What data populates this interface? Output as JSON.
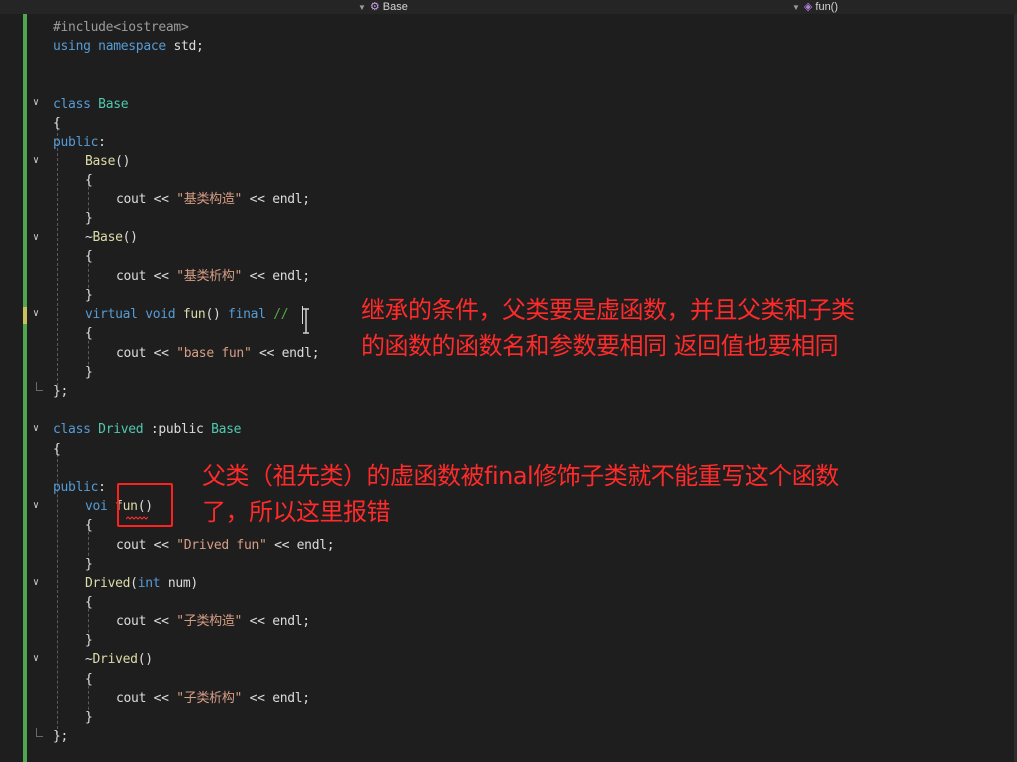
{
  "navbar": {
    "class_dropdown": "Base",
    "member_dropdown": "fun()"
  },
  "code": {
    "l1_include": "#include<iostream>",
    "l2_using": "using",
    "l2_namespace": "namespace",
    "l2_std": " std;",
    "class_kw": "class",
    "base_name": "Base",
    "open_brace": "{",
    "close_brace": "}",
    "class_end": "};",
    "public_kw": "public",
    "colon": ":",
    "base_ctor": "Base",
    "parens": "()",
    "cout": "cout",
    "shift": " << ",
    "endl": "endl;",
    "str_base_ctor": "\"基类构造\"",
    "tilde": "~",
    "str_base_dtor": "\"基类析构\"",
    "virtual_kw": "virtual",
    "void_kw": "void",
    "fun_name": "fun",
    "final_kw": "final",
    "comment": "//",
    "str_base_fun": "\"base fun\"",
    "drived_name": "Drived",
    "inherit": " :public ",
    "void_partial": "voi",
    "str_drived_fun": "\"Drived fun\"",
    "drived_ctor": "Drived",
    "int_kw": "int",
    "num_param": " num)",
    "open_paren": "(",
    "str_child_ctor": "\"子类构造\"",
    "str_child_dtor": "\"子类析构\""
  },
  "annotations": {
    "note1_line1": "继承的条件，父类要是虚函数，并且父类和子类",
    "note1_line2": "的函数的函数名和参数要相同 返回值也要相同",
    "note2_line1": "父类（祖先类）的虚函数被final修饰子类就不能重写这个函数",
    "note2_line2": "了，所以这里报错"
  },
  "colors": {
    "annotation": "#ff2a2a",
    "keyword": "#569cd6",
    "type": "#4ec9b0",
    "string": "#d69d85",
    "function": "#dcdcaa"
  }
}
